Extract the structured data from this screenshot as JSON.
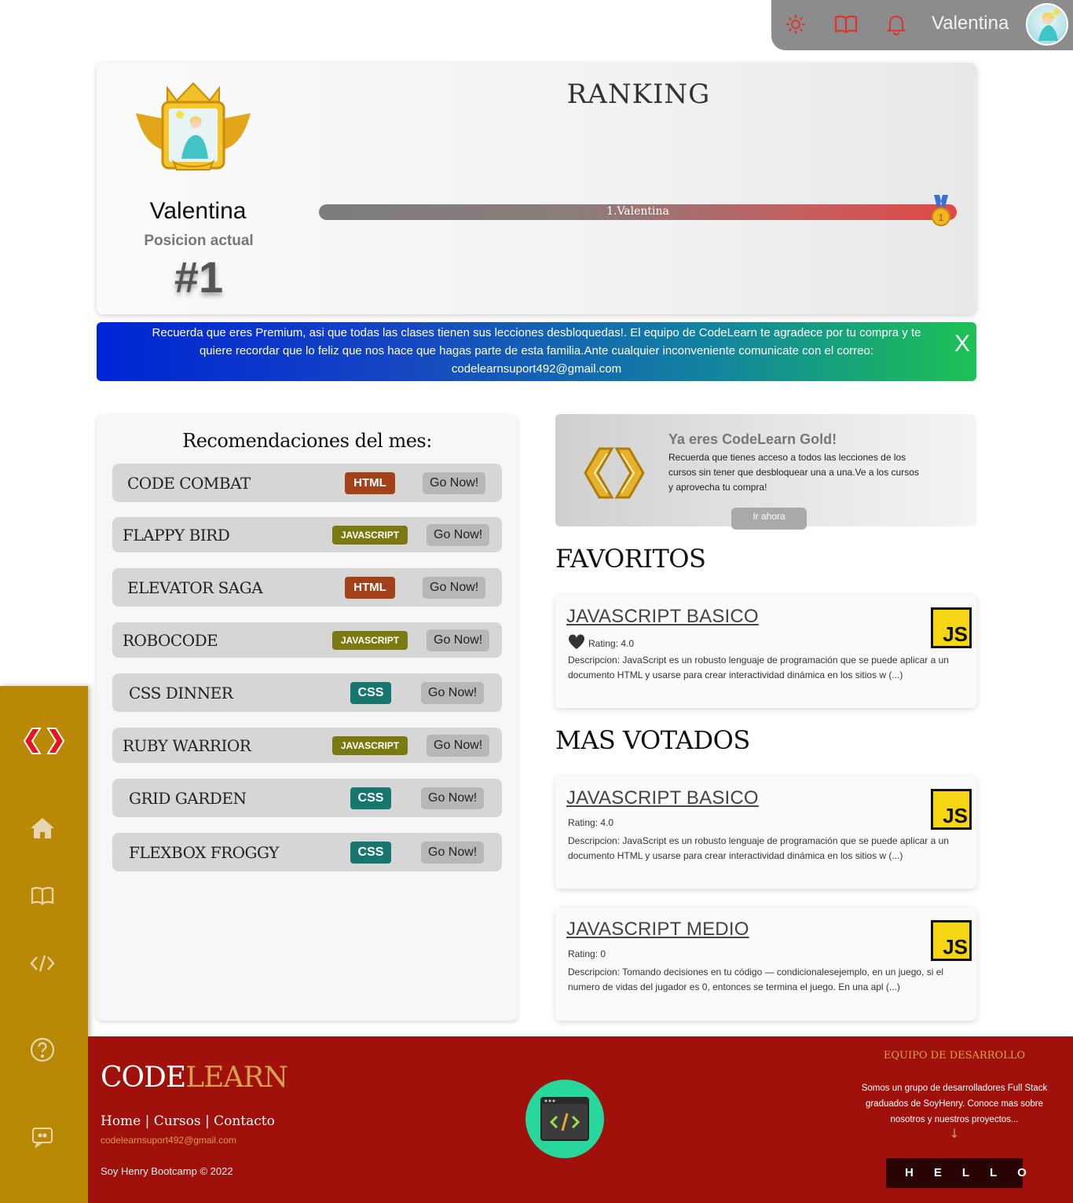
{
  "topbar": {
    "username": "Valentina",
    "icons": [
      "sun-icon",
      "book-icon",
      "bell-icon",
      "avatar"
    ]
  },
  "ranking": {
    "title": "RANKING",
    "username": "Valentina",
    "position_label": "Posicion actual",
    "position": "#1",
    "bar_label": "1.Valentina"
  },
  "notice": {
    "text": "Recuerda que eres Premium, asi que todas las clases tienen sus lecciones desbloquedas!. El equipo de CodeLearn te agradece por tu compra y te quiere recordar que lo feliz que nos hace que hagas parte de esta familia.Ante cualquier inconveniente comunicate con el correo: codelearnsuport492@gmail.com",
    "close": "X"
  },
  "recommendations": {
    "title": "Recomendaciones del mes:",
    "go_label": "Go Now!",
    "items": [
      {
        "name": "CODE COMBAT",
        "tag": "HTML"
      },
      {
        "name": "FLAPPY BIRD",
        "tag": "JAVASCRIPT"
      },
      {
        "name": "ELEVATOR SAGA",
        "tag": "HTML"
      },
      {
        "name": "ROBOCODE",
        "tag": "JAVASCRIPT"
      },
      {
        "name": "CSS DINNER",
        "tag": "CSS"
      },
      {
        "name": "RUBY WARRIOR",
        "tag": "JAVASCRIPT"
      },
      {
        "name": "GRID GARDEN",
        "tag": "CSS"
      },
      {
        "name": "FLEXBOX FROGGY",
        "tag": "CSS"
      }
    ]
  },
  "gold": {
    "title": "Ya eres CodeLearn Gold!",
    "text": "Recuerda que tienes acceso a todos las lecciones de los cursos sin tener que desbloquear una a una.Ve a los cursos y aprovecha tu compra!",
    "button": "Ir ahora"
  },
  "favorites": {
    "title": "FAVORITOS",
    "items": [
      {
        "name": "JAVASCRIPT BASICO",
        "rating": "Rating: 4.0",
        "logo": "JS",
        "description": "Descripcion: JavaScript es un robusto lenguaje de programación que se puede aplicar a un documento HTML y usarse para crear interactividad dinámica en los sitios w (...)"
      }
    ]
  },
  "most_voted": {
    "title": "MAS VOTADOS",
    "items": [
      {
        "name": "JAVASCRIPT BASICO",
        "rating": "Rating: 4.0",
        "logo": "JS",
        "description": "Descripcion: JavaScript es un robusto lenguaje de programación que se puede aplicar a un documento HTML y usarse para crear interactividad dinámica en los sitios w (...)"
      },
      {
        "name": "JAVASCRIPT MEDIO",
        "rating": "Rating: 0",
        "logo": "JS",
        "description": "Descripcion: Tomando decisiones en tu código — condicionalesejemplo, en un juego, si el numero de vidas del jugador es 0, entonces se termina el juego. En una apl (...)"
      }
    ]
  },
  "sidebar": {
    "icons": [
      "codelearn-logo-icon",
      "home-icon",
      "book-icon",
      "code-icon",
      "help-icon",
      "discord-icon"
    ]
  },
  "footer": {
    "brand_a": "CODE",
    "brand_b": "LEARN",
    "links": [
      "Home",
      "Cursos",
      "Contacto"
    ],
    "separator": "|",
    "email": "codelearnsuport492@gmail.com",
    "copyright": "Soy Henry Bootcamp © 2022",
    "team_title": "EQUIPO DE DESARROLLO",
    "team_text": "Somos un grupo de desarrolladores Full Stack graduados de SoyHenry. Conoce mas sobre nosotros y nuestros proyectos...",
    "arrow": "↓",
    "hello": "HELLO"
  },
  "colors": {
    "sidebar": "#b98906",
    "footer": "#a0110c",
    "accent_gold": "#d6a052",
    "icon_red": "#e0322f"
  }
}
